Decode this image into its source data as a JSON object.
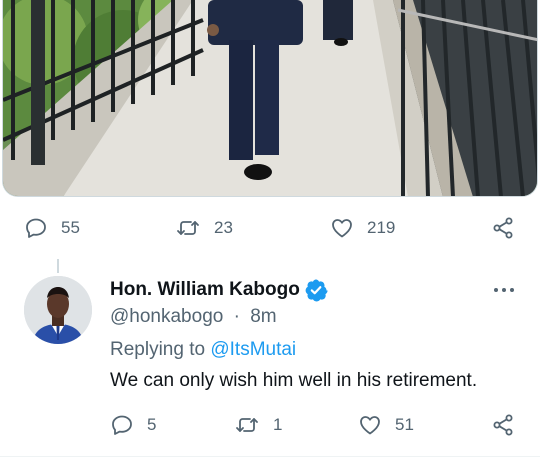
{
  "top_tweet": {
    "stats": {
      "replies": "55",
      "retweets": "23",
      "likes": "219"
    },
    "icons": [
      "reply-icon",
      "retweet-icon",
      "like-icon",
      "share-icon"
    ]
  },
  "reply_tweet": {
    "display_name": "Hon. William Kabogo",
    "verified": true,
    "handle": "@honkabogo",
    "separator": "·",
    "time": "8m",
    "replying_prefix": "Replying to",
    "replying_to": "@ItsMutai",
    "text": "We can only wish him well in his retirement.",
    "stats": {
      "replies": "5",
      "retweets": "1",
      "likes": "51"
    }
  },
  "colors": {
    "text_primary": "#0f1419",
    "text_secondary": "#536471",
    "accent": "#1d9bf0",
    "border": "#cfd9de"
  }
}
